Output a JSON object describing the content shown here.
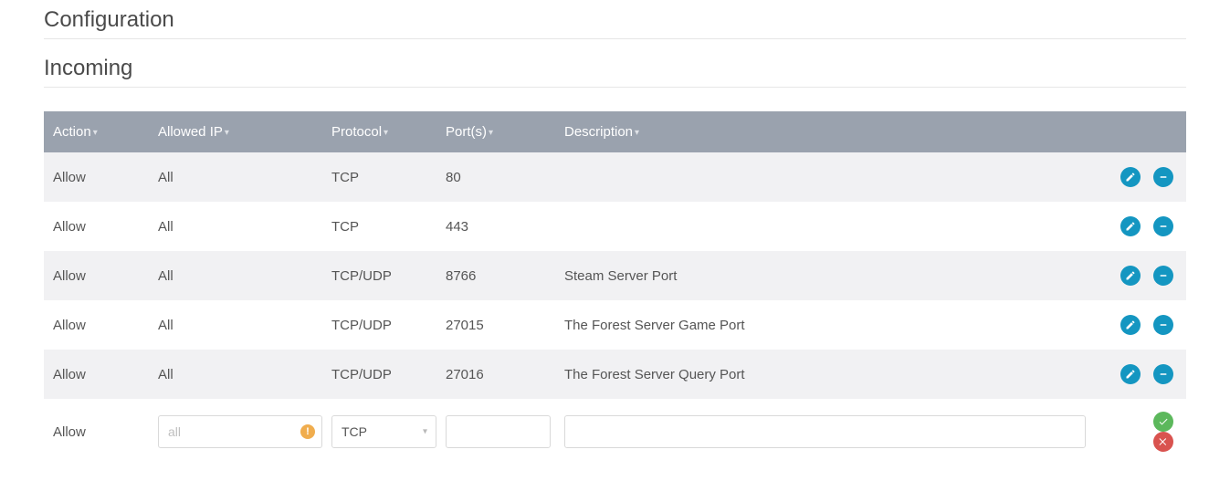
{
  "titles": {
    "configuration": "Configuration",
    "incoming": "Incoming"
  },
  "headers": {
    "action": "Action",
    "allowed_ip": "Allowed IP",
    "protocol": "Protocol",
    "ports": "Port(s)",
    "description": "Description"
  },
  "rows": [
    {
      "action": "Allow",
      "ip": "All",
      "protocol": "TCP",
      "ports": "80",
      "description": ""
    },
    {
      "action": "Allow",
      "ip": "All",
      "protocol": "TCP",
      "ports": "443",
      "description": ""
    },
    {
      "action": "Allow",
      "ip": "All",
      "protocol": "TCP/UDP",
      "ports": "8766",
      "description": "Steam Server Port"
    },
    {
      "action": "Allow",
      "ip": "All",
      "protocol": "TCP/UDP",
      "ports": "27015",
      "description": "The Forest Server Game Port"
    },
    {
      "action": "Allow",
      "ip": "All",
      "protocol": "TCP/UDP",
      "ports": "27016",
      "description": "The Forest Server Query Port"
    }
  ],
  "new_row": {
    "action": "Allow",
    "ip_placeholder": "all",
    "ip_value": "",
    "protocol_value": "TCP",
    "ports_value": "",
    "description_value": ""
  }
}
